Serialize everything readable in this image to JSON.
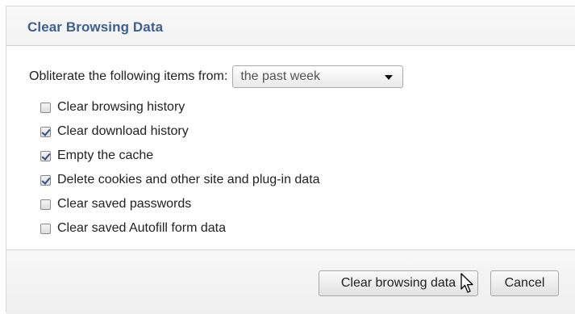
{
  "dialog": {
    "title": "Clear Browsing Data",
    "obliterate_label": "Obliterate the following items from:",
    "time_range": {
      "selected": "the past week"
    },
    "options": [
      {
        "label": "Clear browsing history",
        "checked": false
      },
      {
        "label": "Clear download history",
        "checked": true
      },
      {
        "label": "Empty the cache",
        "checked": true
      },
      {
        "label": "Delete cookies and other site and plug-in data",
        "checked": true
      },
      {
        "label": "Clear saved passwords",
        "checked": false
      },
      {
        "label": "Clear saved Autofill form data",
        "checked": false
      }
    ],
    "buttons": {
      "clear_label": "Clear browsing data",
      "cancel_label": "Cancel"
    }
  },
  "icons": {
    "dropdown_arrow": "chevron-down-icon",
    "cursor": "mouse-pointer-icon"
  },
  "colors": {
    "title": "#3d5f8f",
    "check": "#2f4f7f"
  }
}
